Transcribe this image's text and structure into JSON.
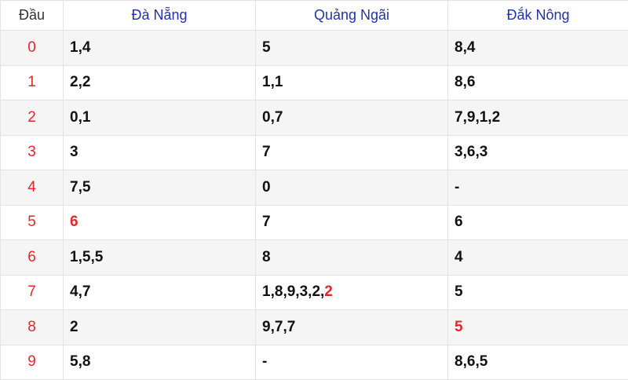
{
  "header": {
    "first_col": "Đầu",
    "provinces": [
      "Đà Nẵng",
      "Quảng Ngãi",
      "Đắk Nông"
    ]
  },
  "highlight_color": "#e3262b",
  "rows": [
    {
      "head": "0",
      "cells": [
        [
          {
            "t": "1"
          },
          {
            "t": ","
          },
          {
            "t": "4"
          }
        ],
        [
          {
            "t": "5"
          }
        ],
        [
          {
            "t": "8"
          },
          {
            "t": ","
          },
          {
            "t": "4"
          }
        ]
      ]
    },
    {
      "head": "1",
      "cells": [
        [
          {
            "t": "2"
          },
          {
            "t": ","
          },
          {
            "t": "2"
          }
        ],
        [
          {
            "t": "1"
          },
          {
            "t": ","
          },
          {
            "t": "1"
          }
        ],
        [
          {
            "t": "8"
          },
          {
            "t": ","
          },
          {
            "t": "6"
          }
        ]
      ]
    },
    {
      "head": "2",
      "cells": [
        [
          {
            "t": "0"
          },
          {
            "t": ","
          },
          {
            "t": "1"
          }
        ],
        [
          {
            "t": "0"
          },
          {
            "t": ","
          },
          {
            "t": "7"
          }
        ],
        [
          {
            "t": "7"
          },
          {
            "t": ","
          },
          {
            "t": "9"
          },
          {
            "t": ","
          },
          {
            "t": "1"
          },
          {
            "t": ","
          },
          {
            "t": "2"
          }
        ]
      ]
    },
    {
      "head": "3",
      "cells": [
        [
          {
            "t": "3"
          }
        ],
        [
          {
            "t": "7"
          }
        ],
        [
          {
            "t": "3"
          },
          {
            "t": ","
          },
          {
            "t": "6"
          },
          {
            "t": ","
          },
          {
            "t": "3"
          }
        ]
      ]
    },
    {
      "head": "4",
      "cells": [
        [
          {
            "t": "7"
          },
          {
            "t": ","
          },
          {
            "t": "5"
          }
        ],
        [
          {
            "t": "0"
          }
        ],
        [
          {
            "t": "-"
          }
        ]
      ]
    },
    {
      "head": "5",
      "cells": [
        [
          {
            "t": "6",
            "hl": true
          }
        ],
        [
          {
            "t": "7"
          }
        ],
        [
          {
            "t": "6"
          }
        ]
      ]
    },
    {
      "head": "6",
      "cells": [
        [
          {
            "t": "1"
          },
          {
            "t": ","
          },
          {
            "t": "5"
          },
          {
            "t": ","
          },
          {
            "t": "5"
          }
        ],
        [
          {
            "t": "8"
          }
        ],
        [
          {
            "t": "4"
          }
        ]
      ]
    },
    {
      "head": "7",
      "cells": [
        [
          {
            "t": "4"
          },
          {
            "t": ","
          },
          {
            "t": "7"
          }
        ],
        [
          {
            "t": "1"
          },
          {
            "t": ","
          },
          {
            "t": "8"
          },
          {
            "t": ","
          },
          {
            "t": "9"
          },
          {
            "t": ","
          },
          {
            "t": "3"
          },
          {
            "t": ","
          },
          {
            "t": "2"
          },
          {
            "t": ","
          },
          {
            "t": "2",
            "hl": true
          }
        ],
        [
          {
            "t": "5"
          }
        ]
      ]
    },
    {
      "head": "8",
      "cells": [
        [
          {
            "t": "2"
          }
        ],
        [
          {
            "t": "9"
          },
          {
            "t": ","
          },
          {
            "t": "7"
          },
          {
            "t": ","
          },
          {
            "t": "7"
          }
        ],
        [
          {
            "t": "5",
            "hl": true
          }
        ]
      ]
    },
    {
      "head": "9",
      "cells": [
        [
          {
            "t": "5"
          },
          {
            "t": ","
          },
          {
            "t": "8"
          }
        ],
        [
          {
            "t": "-"
          }
        ],
        [
          {
            "t": "8"
          },
          {
            "t": ","
          },
          {
            "t": "6"
          },
          {
            "t": ","
          },
          {
            "t": "5"
          }
        ]
      ]
    }
  ]
}
